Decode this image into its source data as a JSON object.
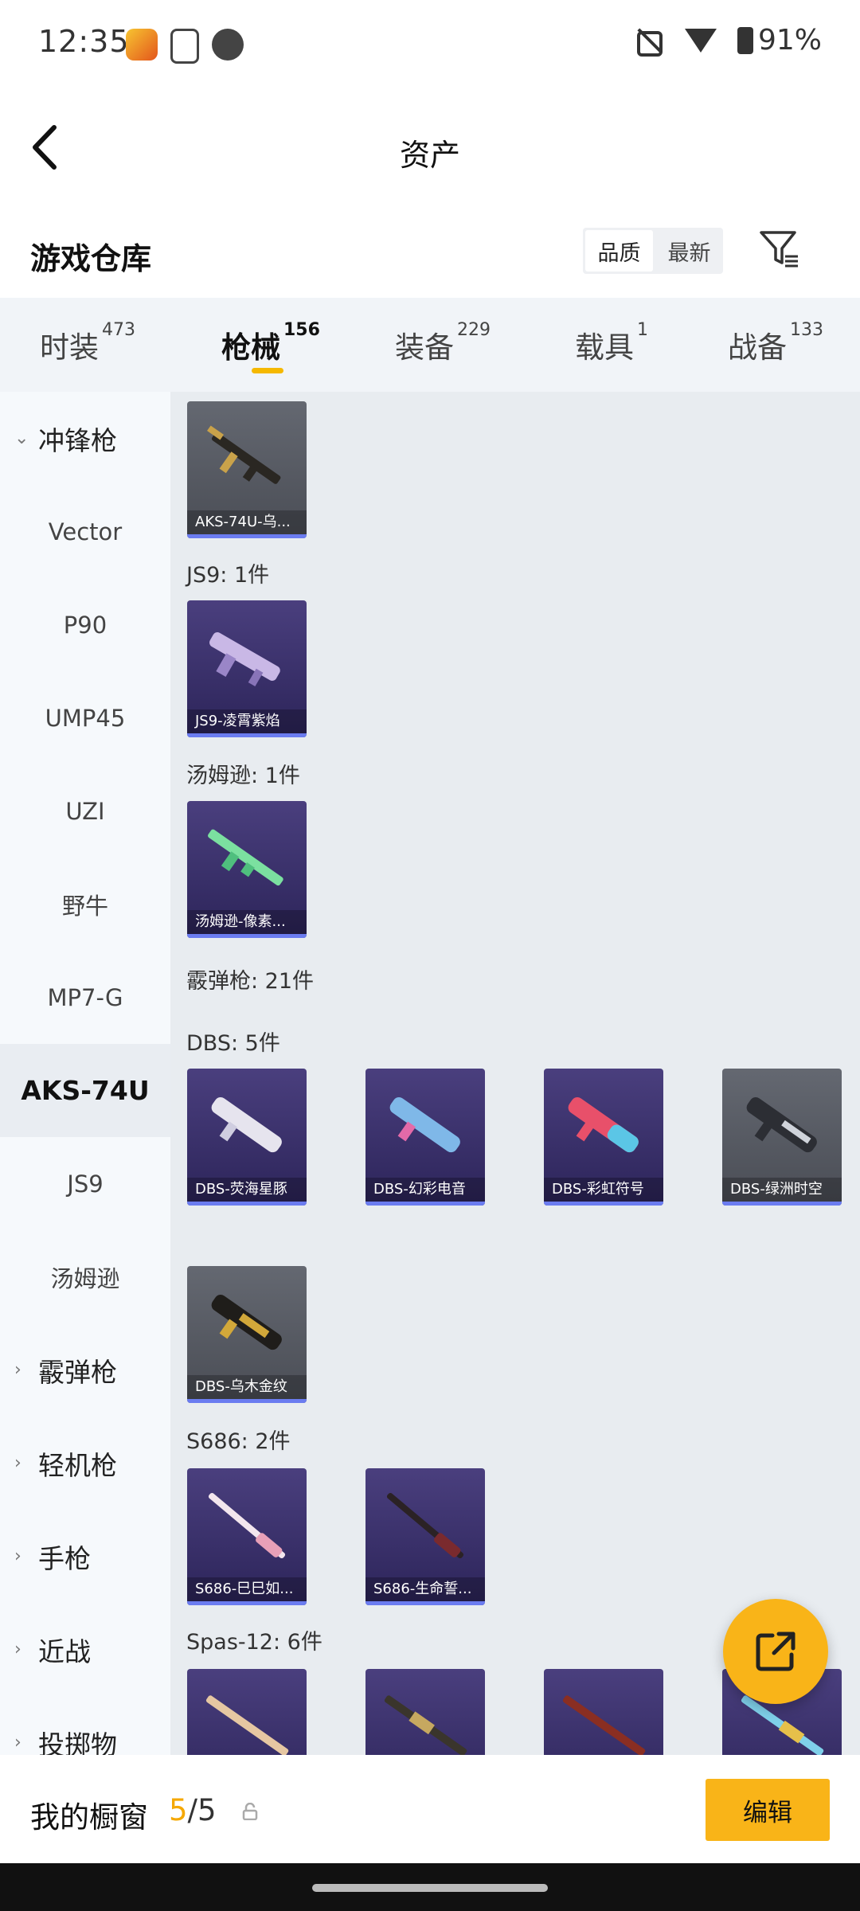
{
  "status": {
    "time": "12:35",
    "battery": "91%"
  },
  "header": {
    "title": "资产"
  },
  "section": {
    "title": "游戏仓库",
    "sort_quality": "品质",
    "sort_newest": "最新"
  },
  "tabs": [
    {
      "label": "时装",
      "count": "473"
    },
    {
      "label": "枪械",
      "count": "156"
    },
    {
      "label": "装备",
      "count": "229"
    },
    {
      "label": "载具",
      "count": "1"
    },
    {
      "label": "战备",
      "count": "133"
    }
  ],
  "sidebar": [
    {
      "label": "冲锋枪",
      "expanded": true
    },
    {
      "label": "Vector"
    },
    {
      "label": "P90"
    },
    {
      "label": "UMP45"
    },
    {
      "label": "UZI"
    },
    {
      "label": "野牛"
    },
    {
      "label": "MP7-G"
    },
    {
      "label": "AKS-74U"
    },
    {
      "label": "JS9"
    },
    {
      "label": "汤姆逊"
    },
    {
      "label": "霰弹枪"
    },
    {
      "label": "轻机枪"
    },
    {
      "label": "手枪"
    },
    {
      "label": "近战"
    },
    {
      "label": "投掷物"
    }
  ],
  "content": {
    "card_aks": "AKS-74U-乌...",
    "heading_js9": "JS9: 1件",
    "card_js9": "JS9-凌霄紫焰",
    "heading_thompson": "汤姆逊: 1件",
    "card_thompson": "汤姆逊-像素...",
    "heading_shotgun": "霰弹枪: 21件",
    "heading_dbs": "DBS: 5件",
    "dbs_cards": [
      "DBS-荧海星豚",
      "DBS-幻彩电音",
      "DBS-彩虹符号",
      "DBS-绿洲时空",
      "DBS-乌木金纹"
    ],
    "heading_s686": "S686: 2件",
    "s686_cards": [
      "S686-巳巳如...",
      "S686-生命誓..."
    ],
    "heading_spas": "Spas-12: 6件"
  },
  "bottom": {
    "showcase_label": "我的橱窗",
    "showcase_current": "5",
    "showcase_total": "/5",
    "edit_label": "编辑"
  },
  "colors": {
    "accent": "#f9b418",
    "card_purple": "#3a3070",
    "card_gray": "#5a5d66",
    "card_bar": "#6b7cf0"
  }
}
